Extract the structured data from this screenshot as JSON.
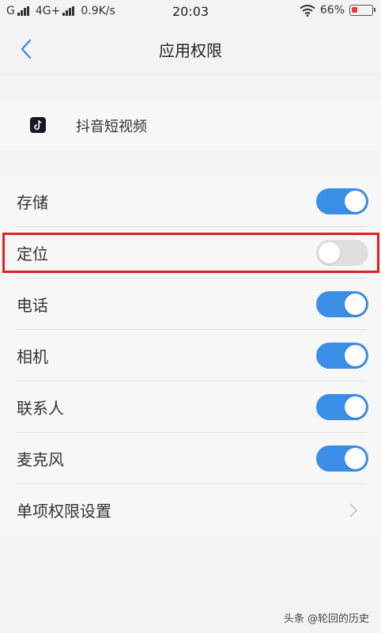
{
  "status_bar": {
    "network": "G",
    "network2": "4G+",
    "speed": "0.9K/s",
    "time": "20:03",
    "battery": "66%",
    "battery_level": 0.3
  },
  "header": {
    "title": "应用权限",
    "back_icon": "chevron-left-icon"
  },
  "app": {
    "name": "抖音短视频",
    "icon": "tiktok-app-icon"
  },
  "rows": [
    {
      "label": "存储",
      "control": "toggle",
      "on": true
    },
    {
      "label": "定位",
      "control": "toggle",
      "on": false
    },
    {
      "label": "电话",
      "control": "toggle",
      "on": true
    },
    {
      "label": "相机",
      "control": "toggle",
      "on": true
    },
    {
      "label": "联系人",
      "control": "toggle",
      "on": true
    },
    {
      "label": "麦克风",
      "control": "toggle",
      "on": true
    },
    {
      "label": "单项权限设置",
      "control": "chevron",
      "icon": "chevron-right-icon"
    }
  ],
  "watermark": "头条 @轮回的历史",
  "colors": {
    "accent": "#3a8ee6",
    "toggle_off": "#dedede",
    "highlight": "#e02020"
  }
}
